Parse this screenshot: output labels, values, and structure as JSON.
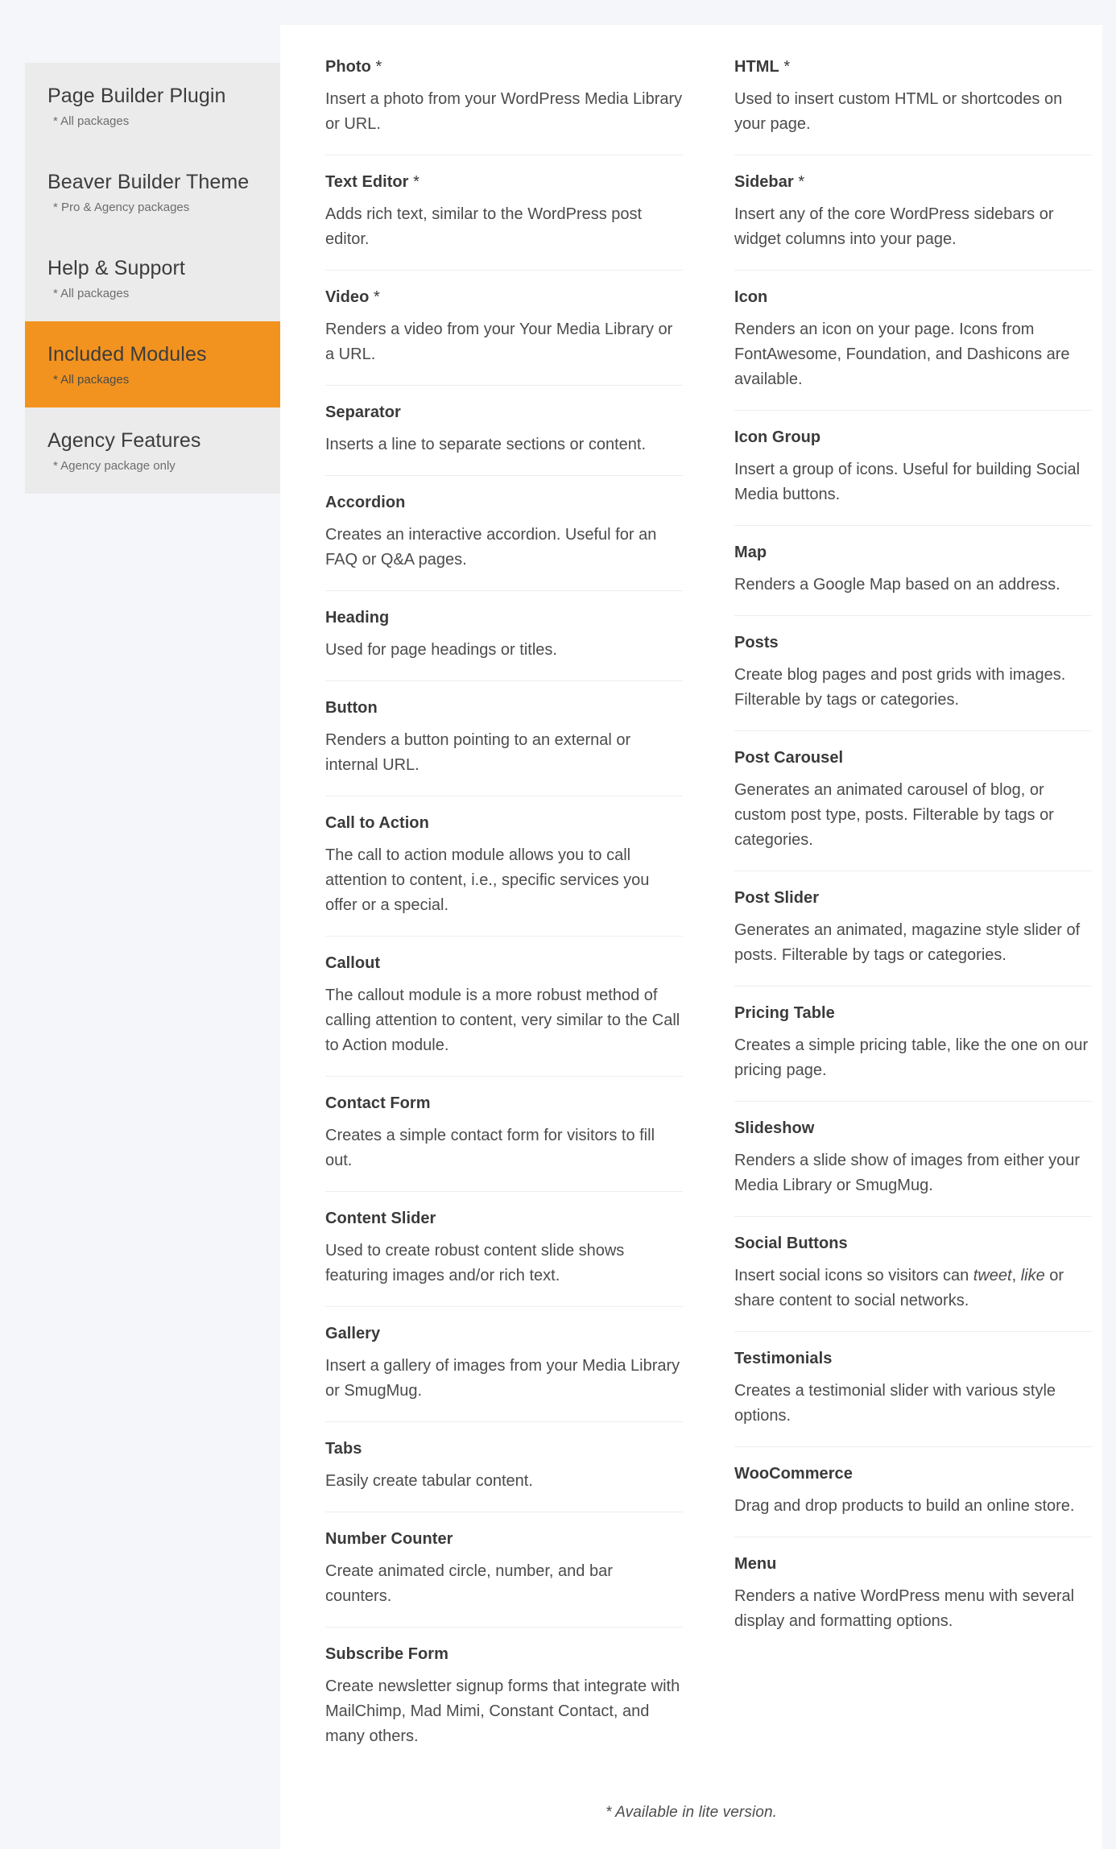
{
  "sidebar": {
    "items": [
      {
        "title": "Page Builder Plugin",
        "sub": "* All packages",
        "active": false
      },
      {
        "title": "Beaver Builder Theme",
        "sub": "* Pro & Agency packages",
        "active": false
      },
      {
        "title": "Help & Support",
        "sub": "* All packages",
        "active": false
      },
      {
        "title": "Included Modules",
        "sub": "* All packages",
        "active": true
      },
      {
        "title": "Agency Features",
        "sub": "* Agency package only",
        "active": false
      }
    ],
    "active_color": "#f3931f",
    "inactive_color": "#ebebeb"
  },
  "main": {
    "left_column": [
      {
        "title": "Photo",
        "star": " *",
        "desc": "Insert a photo from your WordPress Media Library or URL."
      },
      {
        "title": "Text Editor",
        "star": " *",
        "desc": "Adds rich text, similar to the WordPress post editor."
      },
      {
        "title": "Video",
        "star": " *",
        "desc": "Renders a video from your Your Media Library or a URL."
      },
      {
        "title": "Separator",
        "star": "",
        "desc": "Inserts a line to separate sections or content."
      },
      {
        "title": "Accordion",
        "star": "",
        "desc": "Creates an interactive accordion. Useful for an FAQ or Q&A pages."
      },
      {
        "title": "Heading",
        "star": "",
        "desc": "Used for page headings or titles."
      },
      {
        "title": "Button",
        "star": "",
        "desc": "Renders a button pointing to an external or internal URL."
      },
      {
        "title": "Call to Action",
        "star": "",
        "desc": "The call to action module allows you to call attention to content, i.e., specific services you offer or a special."
      },
      {
        "title": "Callout",
        "star": "",
        "desc": "The callout module is a more robust method of calling attention to content, very similar to the Call to Action module."
      },
      {
        "title": "Contact Form",
        "star": "",
        "desc": "Creates a simple contact form for visitors to fill out."
      },
      {
        "title": "Content Slider",
        "star": "",
        "desc": "Used to create robust content slide shows featuring images and/or rich text."
      },
      {
        "title": "Gallery",
        "star": "",
        "desc": "Insert a gallery of images from your Media Library or SmugMug."
      },
      {
        "title": "Tabs",
        "star": "",
        "desc": "Easily create tabular content."
      },
      {
        "title": "Number Counter",
        "star": "",
        "desc": "Create animated circle, number, and bar counters."
      },
      {
        "title": "Subscribe Form",
        "star": "",
        "desc": "Create newsletter signup forms that integrate with MailChimp, Mad Mimi, Constant Contact, and many others."
      }
    ],
    "right_column": [
      {
        "title": "HTML",
        "star": " *",
        "desc": "Used to insert custom HTML or shortcodes on your page."
      },
      {
        "title": "Sidebar",
        "star": " *",
        "desc": "Insert any of the core WordPress sidebars or widget columns into your page."
      },
      {
        "title": "Icon",
        "star": "",
        "desc": "Renders an icon on your page. Icons from FontAwesome, Foundation, and Dashicons are available."
      },
      {
        "title": "Icon Group",
        "star": "",
        "desc": "Insert a group of icons. Useful for building Social Media buttons."
      },
      {
        "title": "Map",
        "star": "",
        "desc": "Renders a Google Map based on an address."
      },
      {
        "title": "Posts",
        "star": "",
        "desc": "Create blog pages and post grids with images. Filterable by tags or categories."
      },
      {
        "title": "Post Carousel",
        "star": "",
        "desc": "Generates an animated carousel of blog, or custom post type, posts. Filterable by tags or categories."
      },
      {
        "title": "Post Slider",
        "star": "",
        "desc": "Generates an animated, magazine style slider of posts. Filterable by tags or categories."
      },
      {
        "title": "Pricing Table",
        "star": "",
        "desc": "Creates a simple pricing table, like the one on our pricing page."
      },
      {
        "title": "Slideshow",
        "star": "",
        "desc": "Renders a slide show of images from either your Media Library or SmugMug."
      },
      {
        "title": "Social Buttons",
        "star": "",
        "desc_html": "Insert social icons so visitors can <em>tweet</em>, <em>like</em> or share content to social networks."
      },
      {
        "title": "Testimonials",
        "star": "",
        "desc": "Creates a testimonial slider with various style options."
      },
      {
        "title": "WooCommerce",
        "star": "",
        "desc": "Drag and drop products to build an online store."
      },
      {
        "title": "Menu",
        "star": "",
        "desc": "Renders a native WordPress menu with several display and formatting options."
      }
    ],
    "footnote": "* Available in lite version."
  }
}
